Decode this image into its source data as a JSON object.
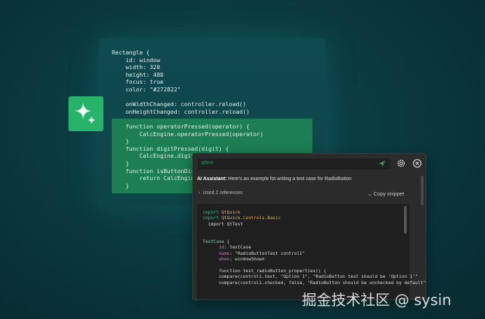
{
  "editor": {
    "lines": [
      "Rectangle {",
      "    id: window",
      "    width: 320",
      "    height: 480",
      "    focus: true",
      "    color: \"#272822\"",
      "",
      "    onWidthChanged: controller.reload()",
      "    onHeightChanged: controller.reload()",
      "",
      "    function operatorPressed(operator) {",
      "        CalcEngine.operatorPressed(operator)",
      "    }",
      "    function digitPressed(digit) {",
      "        CalcEngine.digitPressed(digit)",
      "    }",
      "    function isButtonDisabled(op) {",
      "        return CalcEngine.isOperationDisabled(op)",
      "    }"
    ]
  },
  "ai_panel": {
    "prompt_value": "q/test",
    "message_label": "AI Assistant:",
    "message_text": " Here's an example fot writing a test case for RadioButton",
    "references": "Used 2 references",
    "copy_snippet": "Copy snippet",
    "snippet": [
      [
        [
          "kw",
          "import"
        ],
        [
          "ty",
          " QtQuick"
        ]
      ],
      [
        [
          "kw",
          "import"
        ],
        [
          "ty",
          " QtQuick.Controls.Basic"
        ]
      ],
      [
        [
          "",
          "  import QtTest"
        ]
      ],
      [
        [
          "",
          ""
        ]
      ],
      [
        [
          "",
          ""
        ]
      ],
      [
        [
          "tc",
          "TestCase"
        ],
        [
          "",
          " {"
        ]
      ],
      [
        [
          "pr",
          "      id"
        ],
        [
          "",
          ": testCase"
        ]
      ],
      [
        [
          "pr",
          "      name"
        ],
        [
          "",
          ": \"RadioButtonTest control1\""
        ]
      ],
      [
        [
          "pr",
          "      when"
        ],
        [
          "",
          ": windowShown"
        ]
      ],
      [
        [
          "",
          ""
        ]
      ],
      [
        [
          "",
          "      function test_radioButton_properties() {"
        ]
      ],
      [
        [
          "",
          "      compare(control1.text, \"Option 1\", \"RadioButton text should be 'Option 1'\""
        ]
      ],
      [
        [
          "",
          "      compare(control1.checked, false, \"RadioButton should be unchecked by default\""
        ]
      ]
    ]
  },
  "watermark": "掘金技术社区 @ sysin",
  "colors": {
    "accent": "#27b46a",
    "highlight": "#1c7e52",
    "panel": "#2b2b2b"
  }
}
